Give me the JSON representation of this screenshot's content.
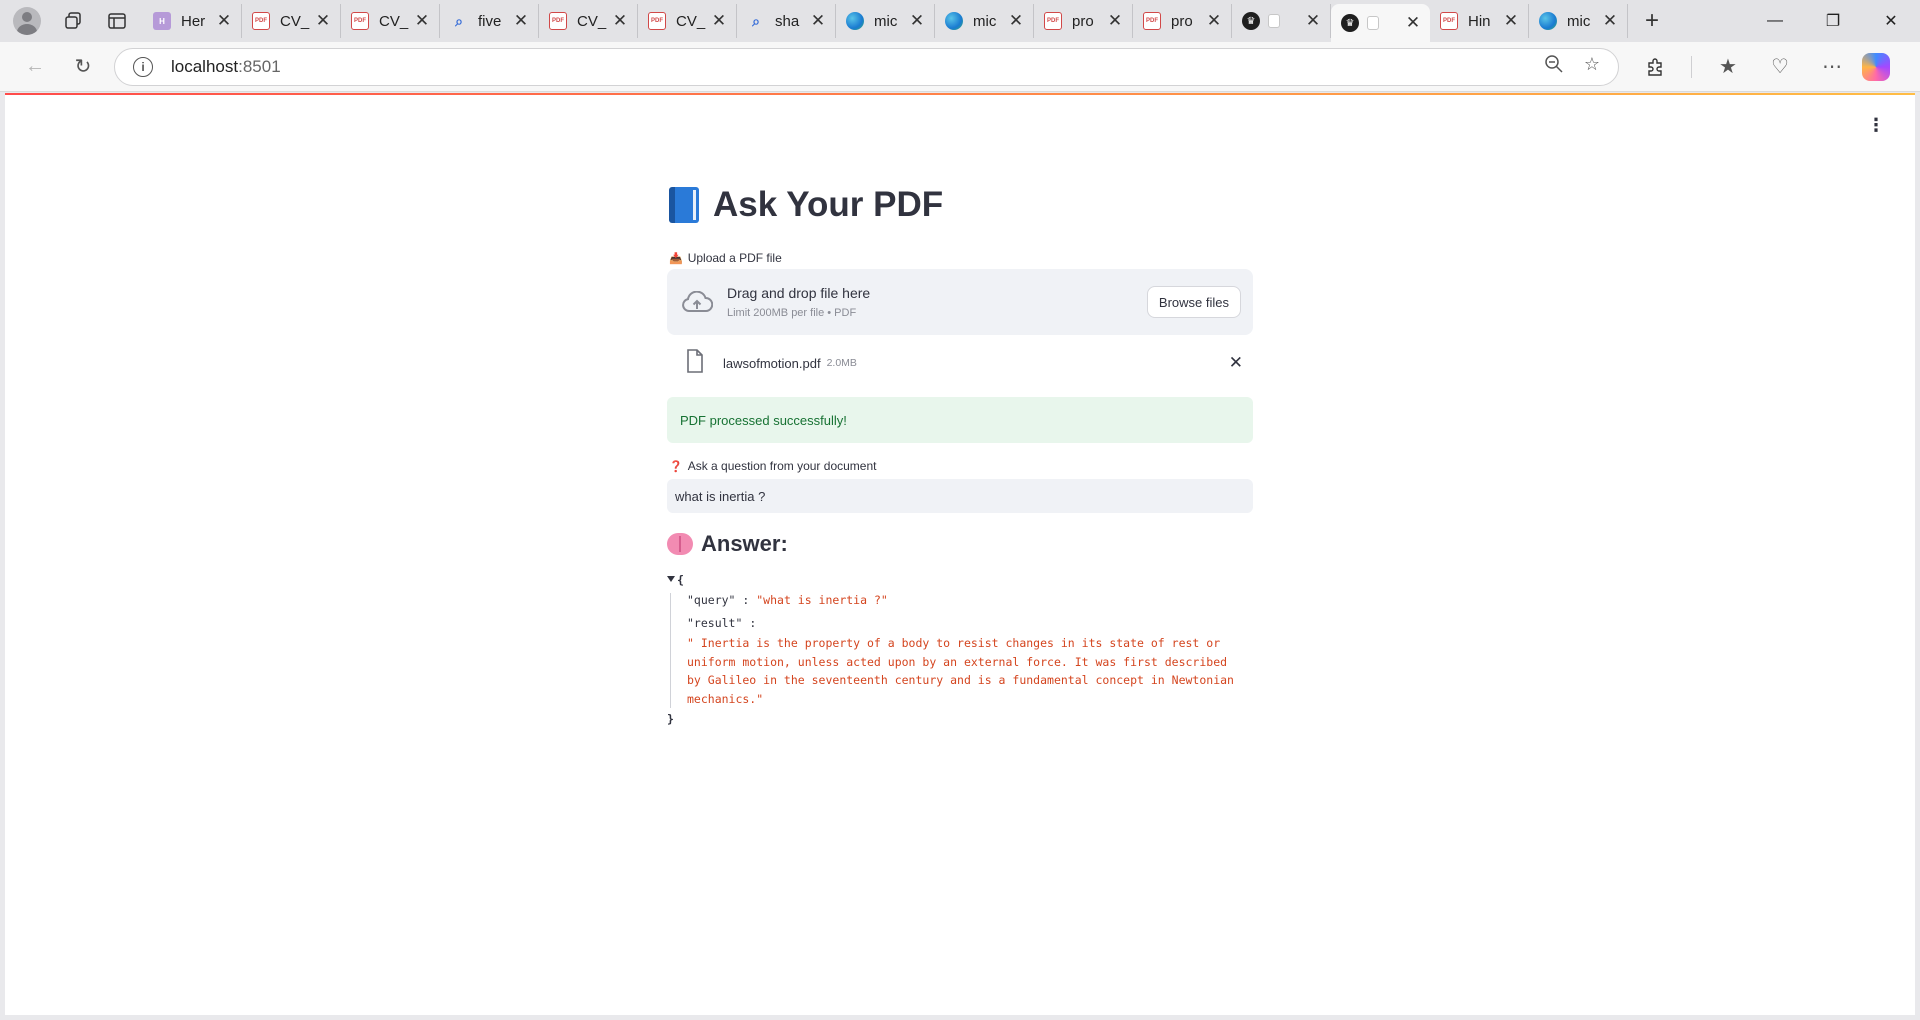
{
  "browser": {
    "tabs": [
      {
        "title": "Her",
        "favicon": "h-icon"
      },
      {
        "title": "CV_",
        "favicon": "pdf-icon"
      },
      {
        "title": "CV_",
        "favicon": "pdf-icon"
      },
      {
        "title": "five",
        "favicon": "search-icon"
      },
      {
        "title": "CV_",
        "favicon": "pdf-icon"
      },
      {
        "title": "CV_",
        "favicon": "pdf-icon"
      },
      {
        "title": "sha",
        "favicon": "search-icon"
      },
      {
        "title": "mic",
        "favicon": "edge-icon"
      },
      {
        "title": "mic",
        "favicon": "edge-icon"
      },
      {
        "title": "pro",
        "favicon": "pdf-icon"
      },
      {
        "title": "pro",
        "favicon": "pdf-icon"
      },
      {
        "title": "",
        "favicon": "crown-icon"
      },
      {
        "title": "",
        "favicon": "crown-icon",
        "active": true
      },
      {
        "title": "Hin",
        "favicon": "pdf-icon"
      },
      {
        "title": "mic",
        "favicon": "edge-icon"
      }
    ],
    "address": {
      "host": "localhost",
      "port": ":8501"
    }
  },
  "app": {
    "title": "Ask Your PDF",
    "upload_label": "Upload a PDF file",
    "dropzone": {
      "main": "Drag and drop file here",
      "sub": "Limit 200MB per file • PDF",
      "button": "Browse files"
    },
    "file": {
      "name": "lawsofmotion.pdf",
      "size": "2.0MB"
    },
    "success_message": "PDF processed successfully!",
    "question_label": "Ask a question from your document",
    "question_value": "what is inertia ?",
    "answer_heading": "Answer:",
    "json": {
      "open_brace": "{",
      "close_brace": "}",
      "query_key": "\"query\"",
      "query_sep": " : ",
      "query_value": "\"what is inertia ?\"",
      "result_key": "\"result\"",
      "result_sep": " :",
      "result_value": "\" Inertia is the property of a body to resist changes in its state of rest or uniform motion, unless acted upon by an external force. It was first described by Galileo in the seventeenth century and is a fundamental concept in Newtonian mechanics.\""
    }
  }
}
